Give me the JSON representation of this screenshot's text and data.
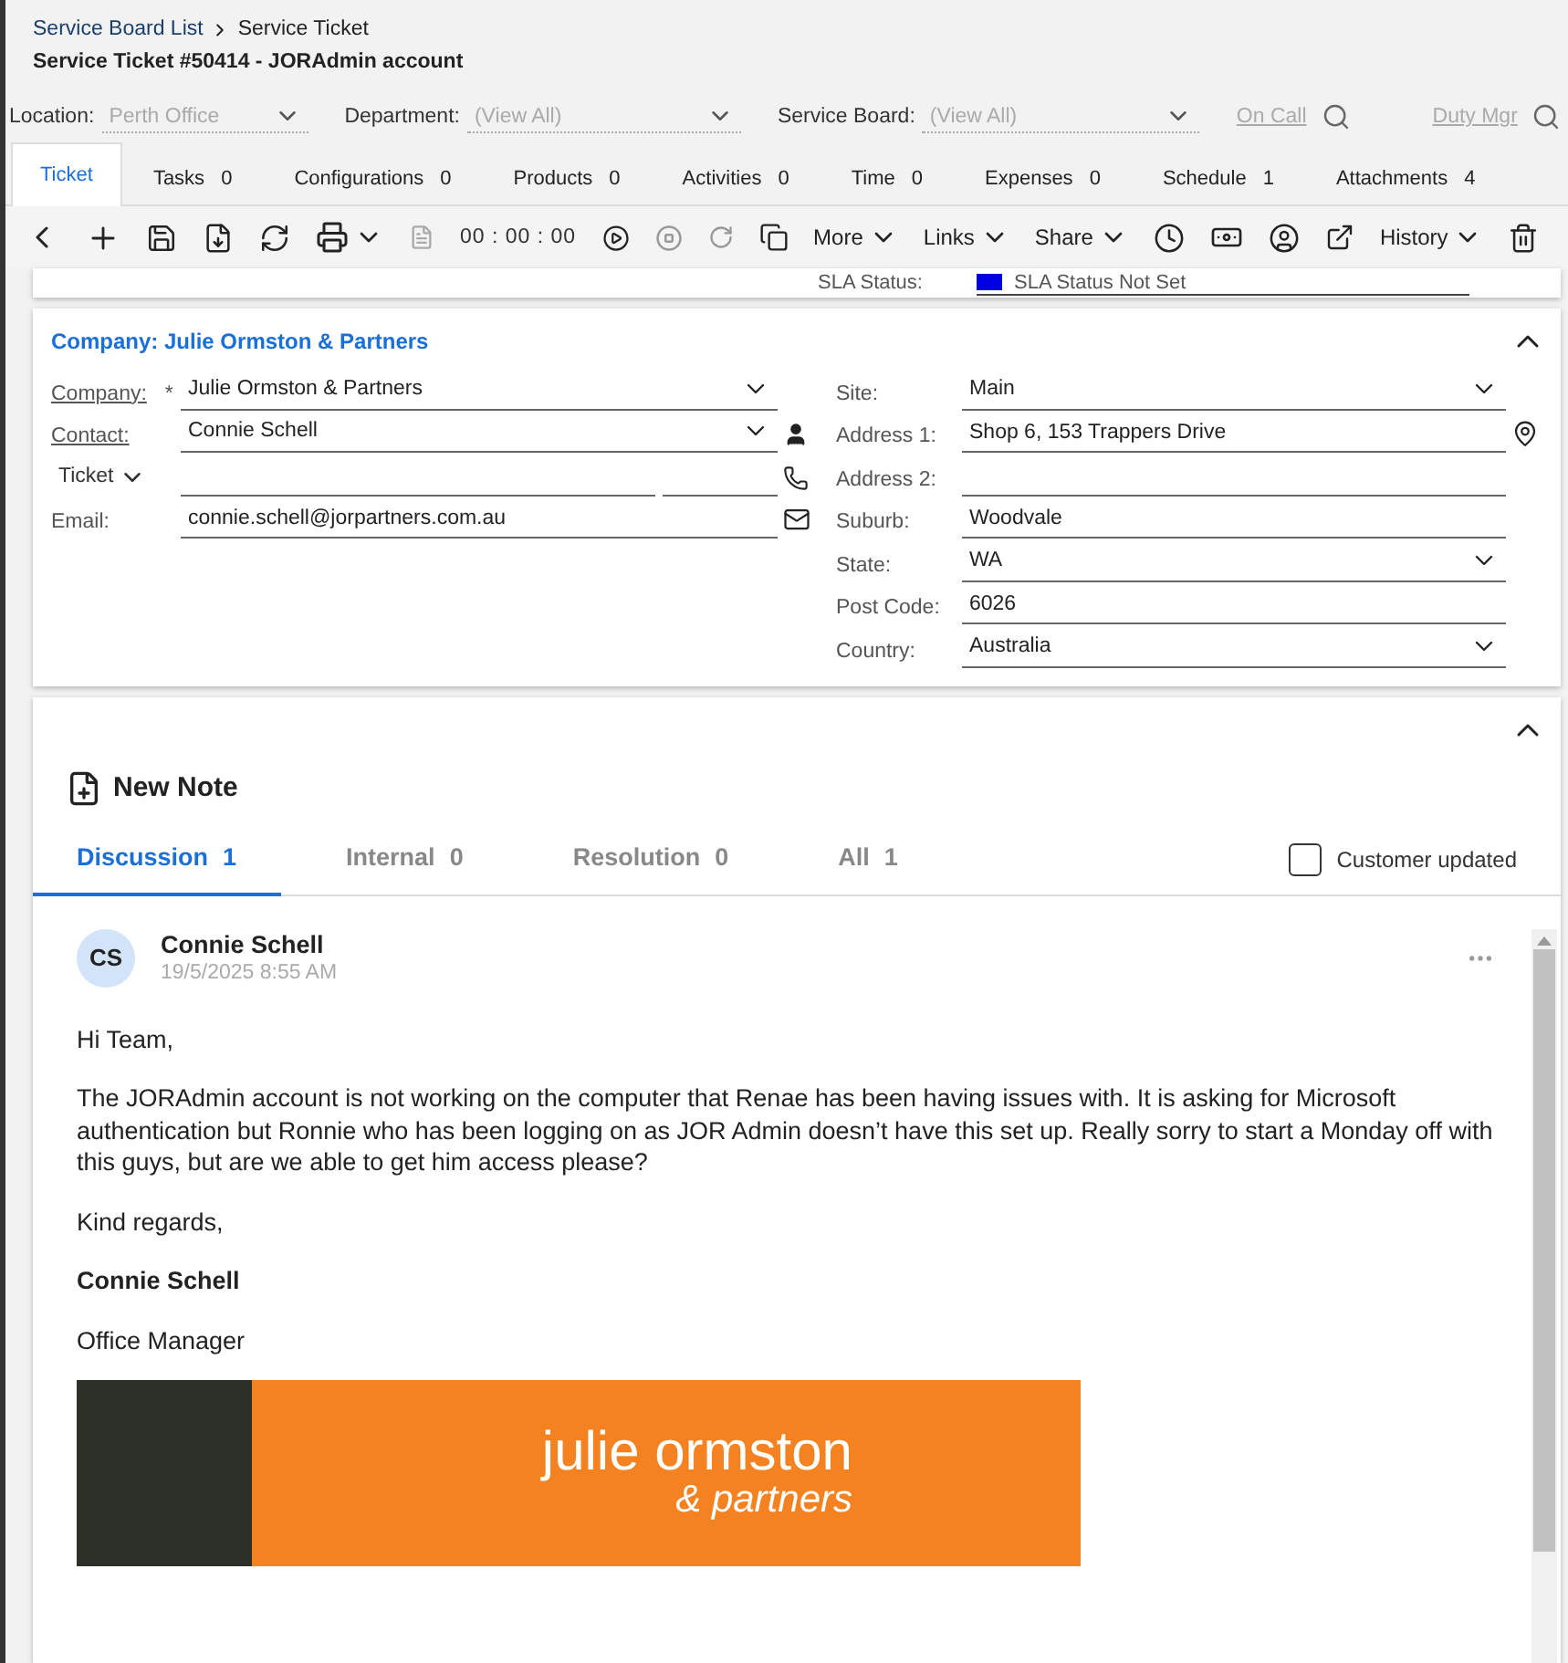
{
  "breadcrumb": [
    {
      "label": "Service Board List",
      "link": true
    },
    {
      "label": "Service Ticket",
      "link": false
    }
  ],
  "title": "Service Ticket #50414 - JORAdmin account",
  "filters": [
    {
      "label": "Location:",
      "value": "Perth Office"
    },
    {
      "label": "Department:",
      "value": "(View All)"
    },
    {
      "label": "Service Board:",
      "value": "(View All)"
    }
  ],
  "filter_links": [
    "On Call",
    "Duty Mgr"
  ],
  "tabs": [
    {
      "label": "Ticket",
      "selected": true
    },
    {
      "label": "Tasks",
      "count": "0",
      "selected": false
    },
    {
      "label": "Configurations",
      "count": "0",
      "selected": false
    },
    {
      "label": "Products",
      "count": "0",
      "selected": false
    },
    {
      "label": "Activities",
      "count": "0",
      "selected": false
    },
    {
      "label": "Time",
      "count": "0",
      "selected": false
    },
    {
      "label": "Expenses",
      "count": "0",
      "selected": false
    },
    {
      "label": "Schedule",
      "count": "1",
      "selected": false
    },
    {
      "label": "Attachments",
      "count": "4",
      "selected": false
    }
  ],
  "toolbar": {
    "timer": "00 : 00 : 00",
    "menus": [
      "More",
      "Links",
      "Share",
      "History"
    ]
  },
  "sla": {
    "label": "SLA Status:",
    "value": "SLA Status Not Set",
    "color": "#0000e0"
  },
  "company": {
    "title": "Company: Julie Ormston & Partners",
    "left": [
      {
        "kind": "select",
        "label": "Company:",
        "link": true,
        "required_mark": "*",
        "value": "Julie Ormston & Partners"
      },
      {
        "kind": "contact",
        "label": "Contact:",
        "link": true,
        "value": "Connie Schell"
      },
      {
        "kind": "phone",
        "label": "Ticket",
        "link": false
      },
      {
        "kind": "email",
        "label": "Email:",
        "link": false,
        "value": "connie.schell@jorpartners.com.au"
      }
    ],
    "right": [
      {
        "kind": "select",
        "label": "Site:",
        "value": "Main"
      },
      {
        "kind": "address",
        "label": "Address 1:",
        "value": "Shop 6, 153 Trappers Drive"
      },
      {
        "kind": "text",
        "label": "Address 2:"
      },
      {
        "kind": "text",
        "label": "Suburb:",
        "value": "Woodvale"
      },
      {
        "kind": "select",
        "label": "State:",
        "value": "WA"
      },
      {
        "kind": "text",
        "label": "Post Code:",
        "value": "6026"
      },
      {
        "kind": "select",
        "label": "Country:",
        "value": "Australia"
      }
    ]
  },
  "notes": {
    "new_note": "New Note",
    "tabs": [
      {
        "label": "Discussion",
        "count": "1",
        "selected": true
      },
      {
        "label": "Internal",
        "count": "0",
        "selected": false
      },
      {
        "label": "Resolution",
        "count": "0",
        "selected": false
      },
      {
        "label": "All",
        "count": "1",
        "selected": false
      }
    ],
    "customer_updated": {
      "label": "Customer updated",
      "checked": false
    },
    "entry": {
      "initials": "CS",
      "author": "Connie Schell",
      "time": "19/5/2025 8:55 AM",
      "body": [
        {
          "kind": "text",
          "text": "Hi Team,"
        },
        {
          "kind": "text",
          "text": "The JORAdmin account is not working on the computer that Renae has been having issues with. It is asking for Microsoft authentication but Ronnie who has been logging on as JOR Admin doesn’t have this set up. Really sorry to start a Monday off with this guys, but are we able to get him access please?"
        },
        {
          "kind": "text",
          "text": "Kind regards,"
        },
        {
          "kind": "strong",
          "text": "Connie Schell"
        },
        {
          "kind": "text",
          "text": "Office Manager"
        }
      ],
      "banner": {
        "name": "julie ormston",
        "tagline": "& partners"
      }
    }
  }
}
